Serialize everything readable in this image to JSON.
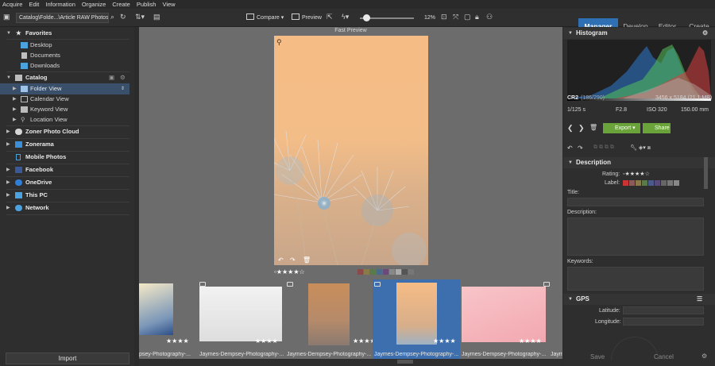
{
  "menu": [
    "Acquire",
    "Edit",
    "Information",
    "Organize",
    "Create",
    "Publish",
    "View"
  ],
  "toolbar": {
    "path": "Catalog\\Folde...\\Article RAW Photos",
    "compare_label": "Compare",
    "preview_label": "Preview",
    "zoom": "12%"
  },
  "modes": [
    "Manager",
    "Develop",
    "Editor",
    "Create"
  ],
  "left": {
    "favorites": {
      "title": "Favorites",
      "items": [
        "Desktop",
        "Documents",
        "Downloads"
      ]
    },
    "catalog": {
      "title": "Catalog",
      "items": [
        "Folder View",
        "Calendar View",
        "Keyword View",
        "Location View"
      ]
    },
    "sources": [
      "Zoner Photo Cloud",
      "Zonerama",
      "Mobile Photos",
      "Facebook",
      "OneDrive",
      "This PC",
      "Network"
    ],
    "import_label": "Import"
  },
  "preview": {
    "label": "Fast Preview",
    "rating": 4
  },
  "thumbnails": [
    {
      "name": "Jaymes-Dempsey-Photography-...",
      "display_name": "psey-Photography-...",
      "rating": 4,
      "selected": false
    },
    {
      "name": "Jaymes-Dempsey-Photography-...",
      "display_name": "Jaymes-Dempsey-Photography-...",
      "rating": 4,
      "selected": false
    },
    {
      "name": "Jaymes-Dempsey-Photography-...",
      "display_name": "Jaymes-Dempsey-Photography-...",
      "rating": 4,
      "selected": false
    },
    {
      "name": "Jaymes-Dempsey-Photography-...",
      "display_name": "Jaymes-Dempsey-Photography-...",
      "rating": 4,
      "selected": true
    },
    {
      "name": "Jaymes-Dempsey-Photography-...",
      "display_name": "Jaymes-Dempsey-Photography-...",
      "rating": 4,
      "selected": false
    },
    {
      "name": "Jaym...",
      "display_name": "Jaym",
      "rating": 0,
      "selected": false
    }
  ],
  "right": {
    "histogram_title": "Histogram",
    "format": "CR2",
    "index": "(186/290)",
    "dimensions": "3456 x 5184 (21.1 MB)",
    "shutter": "1/125 s",
    "aperture": "F2.8",
    "iso": "ISO 320",
    "focal": "150.00 mm",
    "export_label": "Export",
    "share_label": "Share",
    "description_title": "Description",
    "rating_label": "Rating:",
    "label_label": "Label:",
    "title_label": "Title:",
    "description_label": "Description:",
    "keywords_label": "Keywords:",
    "gps_title": "GPS",
    "latitude_label": "Latitude:",
    "longitude_label": "Longitude:",
    "save_label": "Save",
    "cancel_label": "Cancel"
  },
  "colors": {
    "accent": "#2f6fb3",
    "green": "#6aa339",
    "selected_thumb": "#3d6fae"
  }
}
